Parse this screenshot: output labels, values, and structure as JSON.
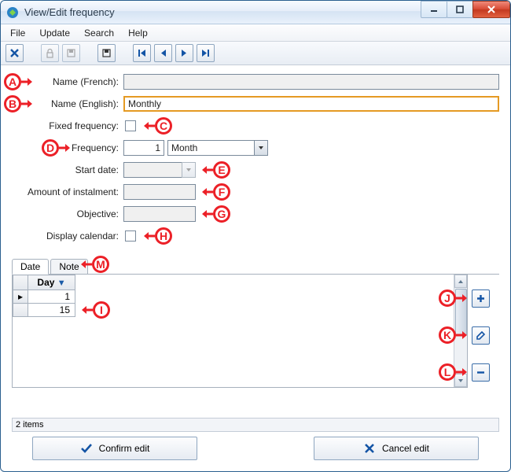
{
  "window": {
    "title": "View/Edit frequency"
  },
  "menu": {
    "file": "File",
    "update": "Update",
    "search": "Search",
    "help": "Help"
  },
  "labels": {
    "name_french": "Name (French):",
    "name_english": "Name (English):",
    "fixed_frequency": "Fixed frequency:",
    "frequency": "Frequency:",
    "start_date": "Start date:",
    "amount_instalment": "Amount of instalment:",
    "objective": "Objective:",
    "display_calendar": "Display calendar:"
  },
  "values": {
    "name_french": "",
    "name_english": "Monthly",
    "frequency_number": "1",
    "frequency_unit": "Month",
    "start_date": "",
    "amount_instalment": "",
    "objective": ""
  },
  "tabs": {
    "date": "Date",
    "note": "Note"
  },
  "grid": {
    "header_day": "Day",
    "rows": [
      "1",
      "15"
    ]
  },
  "status": "2 items",
  "buttons": {
    "confirm": "Confirm edit",
    "cancel": "Cancel edit"
  },
  "callouts": {
    "A": "A",
    "B": "B",
    "C": "C",
    "D": "D",
    "E": "E",
    "F": "F",
    "G": "G",
    "H": "H",
    "I": "I",
    "J": "J",
    "K": "K",
    "L": "L",
    "M": "M"
  }
}
